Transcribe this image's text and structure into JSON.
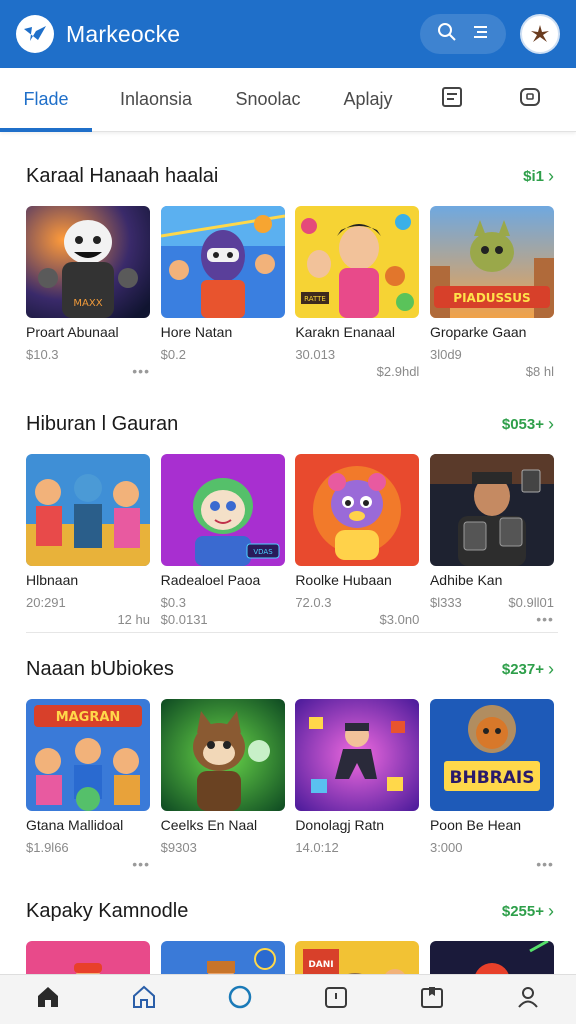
{
  "app": {
    "title": "Markeocke",
    "brand_color": "#1f6fc9",
    "accent_green": "#2e9f4a"
  },
  "tabs": [
    {
      "label": "Flade",
      "active": true
    },
    {
      "label": "Inlaonsia",
      "active": false
    },
    {
      "label": "Snoolac",
      "active": false
    },
    {
      "label": "Aplajy",
      "active": false
    },
    {
      "label": "",
      "icon": "bookmark-icon"
    },
    {
      "label": "",
      "icon": "chat-icon"
    }
  ],
  "sections": [
    {
      "title": "Karaal Hanaah haalai",
      "link": "$i1",
      "items": [
        {
          "name": "Proart Abunaal",
          "price": "$10.3",
          "extra": "",
          "dots": true
        },
        {
          "name": "Hore Natan",
          "price": "$0.2",
          "extra": "",
          "dots": false
        },
        {
          "name": "Karakn Enanaal",
          "price": "30.013",
          "extra": "$2.9hdl",
          "dots": false
        },
        {
          "name": "Groparke Gaan",
          "price": "3l0d9",
          "extra": "$8 hl",
          "dots": false
        }
      ]
    },
    {
      "title": "Hiburan l Gauran",
      "link": "$053+",
      "items": [
        {
          "name": "Hlbnaan",
          "price": "20:291",
          "extra": "12 hu",
          "dots": false
        },
        {
          "name": "Radealoel Paoa",
          "price": "$0.3",
          "extra": "",
          "dots": false,
          "price2": "$0.0131"
        },
        {
          "name": "Roolke Hubaan",
          "price": "72.0.3",
          "extra": "$3.0n0",
          "dots": false
        },
        {
          "name": "Adhibe Kan",
          "price": "$l333",
          "extra": "$0.9ll01",
          "dots": true
        }
      ]
    },
    {
      "title": "Naaan bUbiokes",
      "link": "$237+",
      "items": [
        {
          "name": "Gtana Mallidoal",
          "price": "$1.9l66",
          "extra": "",
          "dots": true
        },
        {
          "name": "Ceelks En Naal",
          "price": "$9303",
          "extra": "",
          "dots": false
        },
        {
          "name": "Donolagj Ratn",
          "price": "14.0:12",
          "extra": "",
          "dots": false
        },
        {
          "name": "Poon Be Hean",
          "price": "3:000",
          "extra": "",
          "dots": true
        }
      ]
    },
    {
      "title": "Kapaky Kamnodle",
      "link": "$255+",
      "items": [
        {
          "name": "",
          "price": "",
          "extra": "",
          "dots": false
        },
        {
          "name": "",
          "price": "",
          "extra": "",
          "dots": false
        },
        {
          "name": "",
          "price": "",
          "extra": "",
          "dots": false
        },
        {
          "name": "",
          "price": "",
          "extra": "",
          "dots": false
        }
      ]
    }
  ],
  "thumb_labels": {
    "s1_1": "MAXX",
    "s1_3": "RATTE",
    "s1_4": "PIADUSSUS",
    "s2_2": "VDAS",
    "s3_1": "MAGRAN",
    "s3_4": "BHBRAIS",
    "s4_3": "DANI"
  },
  "bottom_nav": [
    {
      "icon": "home-filled-icon"
    },
    {
      "icon": "home-outline-icon"
    },
    {
      "icon": "circle-icon"
    },
    {
      "icon": "timer-icon"
    },
    {
      "icon": "library-icon"
    },
    {
      "icon": "profile-icon"
    }
  ]
}
